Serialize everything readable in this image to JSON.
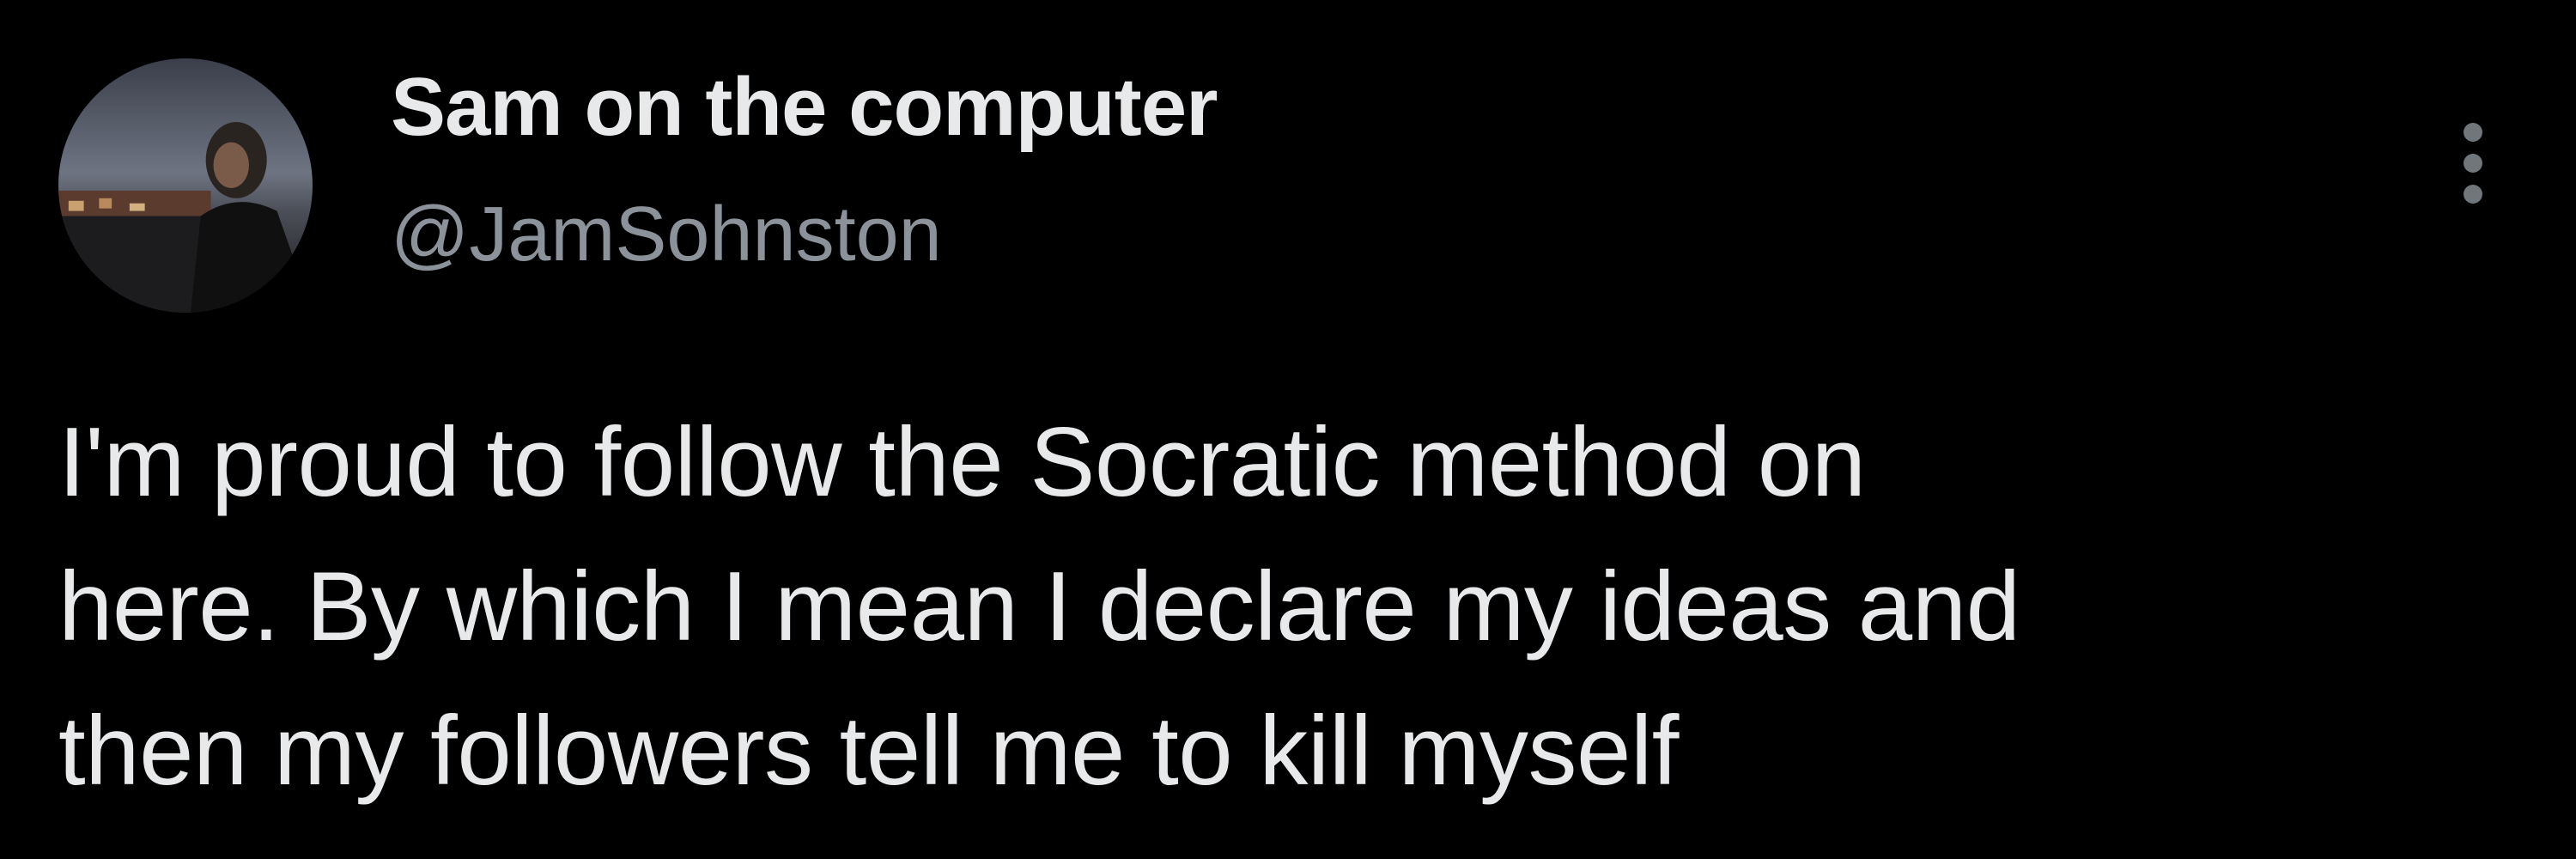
{
  "author": {
    "display_name": "Sam on the computer",
    "handle": "@JamSohnston",
    "avatar_icon": "profile-photo"
  },
  "more_icon": "more-vertical-icon",
  "tweet": {
    "lines": [
      "I'm proud to follow the Socratic method on",
      "here. By which I mean I declare my ideas and",
      "then my followers tell me to kill myself"
    ]
  },
  "colors": {
    "background": "#000000",
    "primary_text": "#e7e9ea",
    "secondary_text": "#8b9299",
    "icon": "#71767b"
  }
}
